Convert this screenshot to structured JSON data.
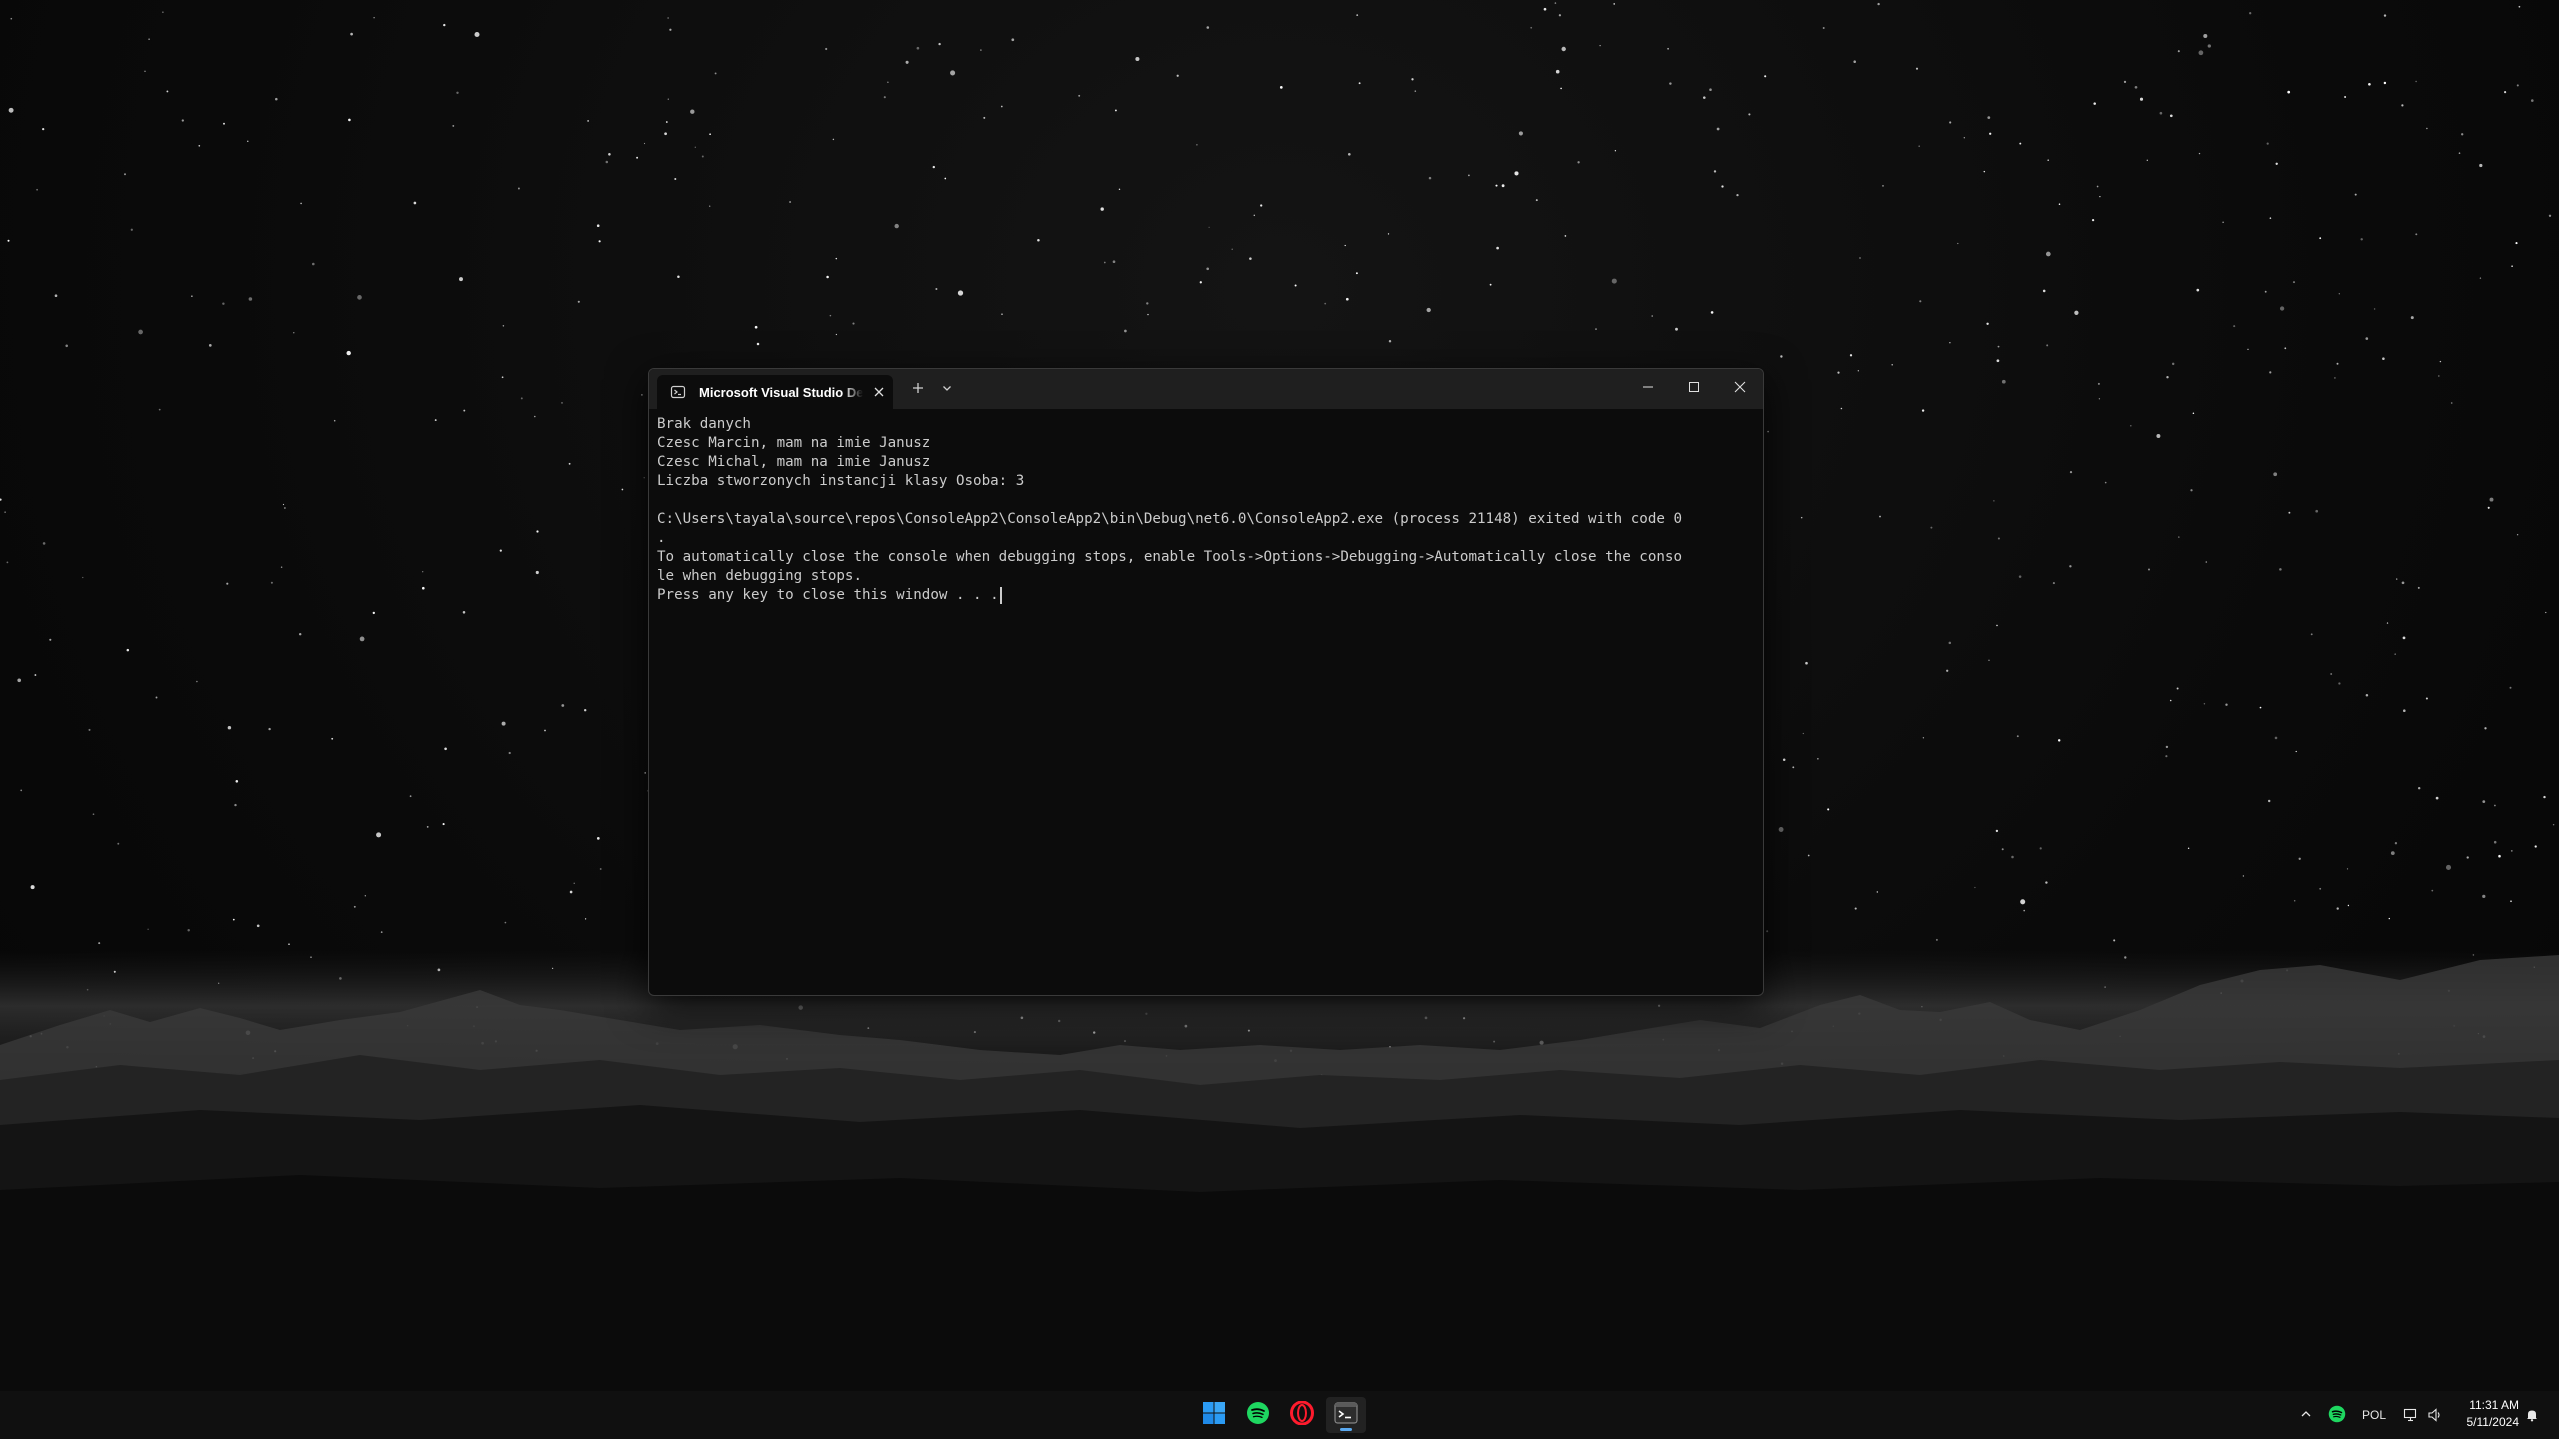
{
  "window": {
    "tab_title": "Microsoft Visual Studio Debug Console",
    "tab_icon": "terminal-icon",
    "new_tab_icon": "plus-icon",
    "dropdown_icon": "chevron-down-icon",
    "minimize_icon": "minimize-icon",
    "maximize_icon": "maximize-icon",
    "close_icon": "close-icon"
  },
  "console": {
    "lines": [
      "Brak danych",
      "Czesc Marcin, mam na imie Janusz",
      "Czesc Michal, mam na imie Janusz",
      "Liczba stworzonych instancji klasy Osoba: 3",
      "",
      "C:\\Users\\tayala\\source\\repos\\ConsoleApp2\\ConsoleApp2\\bin\\Debug\\net6.0\\ConsoleApp2.exe (process 21148) exited with code 0",
      ".",
      "To automatically close the console when debugging stops, enable Tools->Options->Debugging->Automatically close the conso",
      "le when debugging stops.",
      "Press any key to close this window . . ."
    ]
  },
  "taskbar": {
    "apps": [
      {
        "name": "Start",
        "icon": "windows-icon"
      },
      {
        "name": "Spotify",
        "icon": "spotify-icon"
      },
      {
        "name": "Opera",
        "icon": "opera-icon"
      },
      {
        "name": "Terminal",
        "icon": "terminal-icon"
      }
    ],
    "tray": {
      "language": "POL",
      "time": "11:31 AM",
      "date": "5/11/2024"
    }
  },
  "colors": {
    "console_bg": "#0c0c0c",
    "console_text": "#cccccc",
    "titlebar_bg": "#1f1f1f",
    "spotify_green": "#1ed760",
    "opera_red": "#ff1b2d",
    "windows_blue": "#2b9bf4"
  }
}
